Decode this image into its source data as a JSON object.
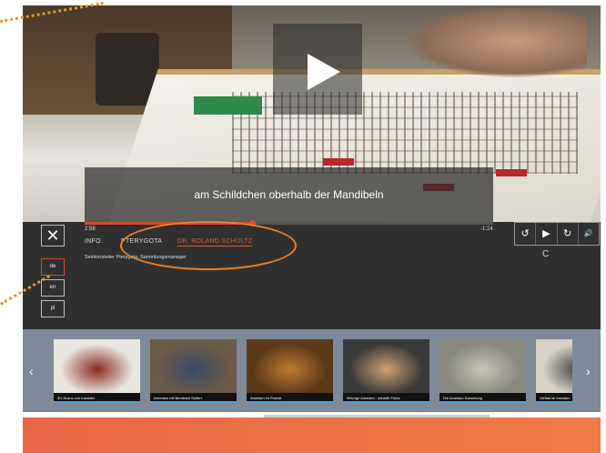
{
  "video": {
    "subtitle": "am Schildchen oberhalb der Mandibeln",
    "time_current": "2:58",
    "time_remaining": "-1:24",
    "progress": 0.41
  },
  "panel": {
    "close_label": "✕",
    "tabs": [
      "INFO",
      "PTERYGOTA",
      "DR. ROLAND SCHULTZ"
    ],
    "description": "Sektionsleiter Pterygota, Sammlungsmanager",
    "languages": [
      "de",
      "en",
      "pl"
    ],
    "controls": [
      "↺",
      "▶",
      "↻",
      "🔊"
    ],
    "control_hint": "C"
  },
  "thumbnails": [
    {
      "caption": "3D-Scans von Insekten",
      "color": "#e9e6e0",
      "accent": "#8a2a20"
    },
    {
      "caption": "Interview mit Bernhard Seifert",
      "color": "#6a5a48",
      "accent": "#3a4a6a"
    },
    {
      "caption": "Ameisen im Porträt",
      "color": "#5a3a1a",
      "accent": "#c07a30"
    },
    {
      "caption": "Winzige Ameisen - scharfe Fotos",
      "color": "#3a3a3a",
      "accent": "#d0a070"
    },
    {
      "caption": "Die Ameisen-Sammlung",
      "color": "#8a8a80",
      "accent": "#c8c4b8"
    },
    {
      "caption": "Vielfalt im Insekten",
      "color": "#d8d2c6",
      "accent": "#3a3a40"
    }
  ],
  "nav": {
    "prev": "‹",
    "next": "›"
  },
  "colors": {
    "accent": "#e2582f",
    "footer": "#ec7045",
    "annotation": "#e8802a"
  }
}
